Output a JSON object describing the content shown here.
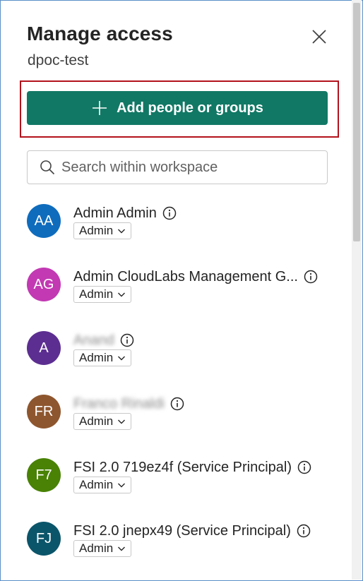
{
  "header": {
    "title": "Manage access",
    "subtitle": "dpoc-test"
  },
  "add_button": {
    "label": "Add people or groups"
  },
  "search": {
    "placeholder": "Search within workspace",
    "value": ""
  },
  "members": [
    {
      "initials": "AA",
      "name": "Admin Admin",
      "role": "Admin",
      "avatar_color": "#0f6cbd",
      "blurred": false
    },
    {
      "initials": "AG",
      "name": "Admin CloudLabs Management G...",
      "role": "Admin",
      "avatar_color": "#c239b3",
      "blurred": false
    },
    {
      "initials": "A",
      "name": "Anand",
      "role": "Admin",
      "avatar_color": "#5c2e91",
      "blurred": true
    },
    {
      "initials": "FR",
      "name": "Franco Rinaldi",
      "role": "Admin",
      "avatar_color": "#8e562e",
      "blurred": true
    },
    {
      "initials": "F7",
      "name": "FSI 2.0 719ez4f (Service Principal)",
      "role": "Admin",
      "avatar_color": "#498205",
      "blurred": false
    },
    {
      "initials": "FJ",
      "name": "FSI 2.0 jnepx49 (Service Principal)",
      "role": "Admin",
      "avatar_color": "#0b556a",
      "blurred": false
    }
  ]
}
